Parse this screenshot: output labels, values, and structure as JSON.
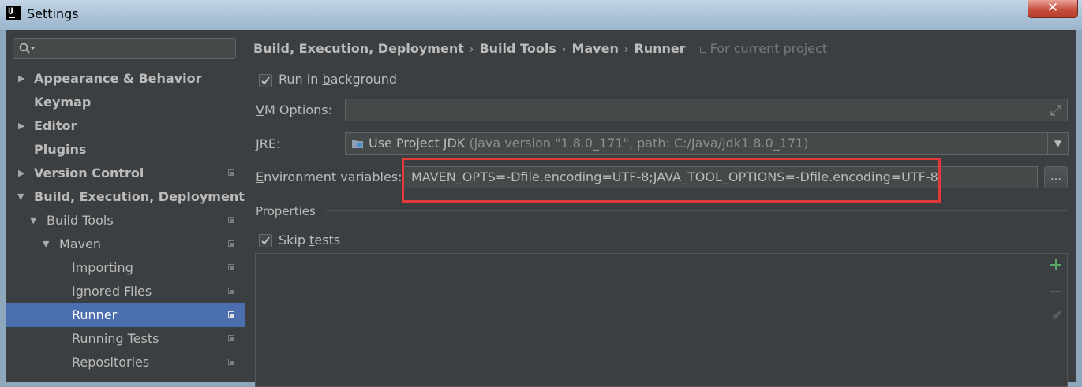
{
  "window": {
    "title": "Settings",
    "close_label": "✕"
  },
  "sidebar": {
    "items": [
      {
        "label": "Appearance & Behavior"
      },
      {
        "label": "Keymap"
      },
      {
        "label": "Editor"
      },
      {
        "label": "Plugins"
      },
      {
        "label": "Version Control"
      },
      {
        "label": "Build, Execution, Deployment"
      },
      {
        "label": "Build Tools"
      },
      {
        "label": "Maven"
      },
      {
        "label": "Importing"
      },
      {
        "label": "Ignored Files"
      },
      {
        "label": "Runner"
      },
      {
        "label": "Running Tests"
      },
      {
        "label": "Repositories"
      }
    ]
  },
  "breadcrumb": {
    "items": [
      "Build, Execution, Deployment",
      "Build Tools",
      "Maven",
      "Runner"
    ],
    "separator": "›",
    "for_current_project": "For current project"
  },
  "runner": {
    "run_in_background": {
      "pre": "Run in ",
      "mnemonic": "b",
      "post": "ackground",
      "checked": true
    },
    "vm_options": {
      "mnemonic": "V",
      "post": "M Options:",
      "value": ""
    },
    "jre": {
      "mnemonic": "J",
      "post": "RE:",
      "value": "Use Project JDK",
      "detail": "(java version \"1.8.0_171\", path: C:/Java/jdk1.8.0_171)"
    },
    "env_vars": {
      "mnemonic": "E",
      "post": "nvironment variables:",
      "value": "MAVEN_OPTS=-Dfile.encoding=UTF-8;JAVA_TOOL_OPTIONS=-Dfile.encoding=UTF-8",
      "browse_label": "..."
    },
    "properties_title": "Properties",
    "skip_tests": {
      "pre": "Skip ",
      "mnemonic": "t",
      "post": "ests",
      "checked": true
    }
  },
  "colors": {
    "background": "#3c3f41",
    "selection": "#4b6eaf",
    "highlight_box": "#e03a3a",
    "add_icon": "#59a869"
  }
}
